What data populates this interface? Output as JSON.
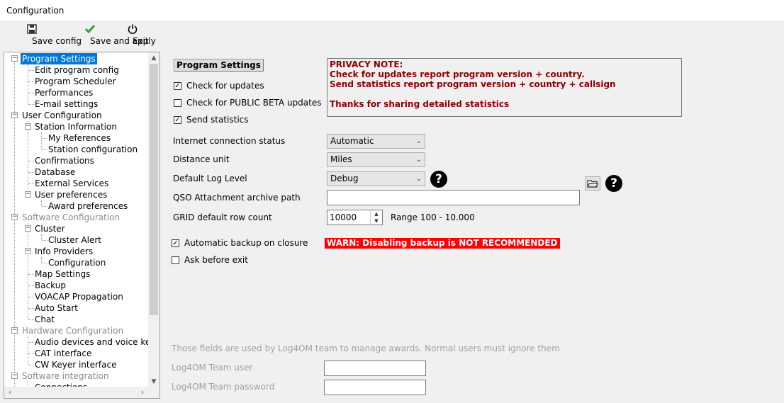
{
  "window": {
    "title": "Configuration"
  },
  "toolbar": {
    "save_config": "Save config",
    "save_apply": "Save and apply",
    "exit": "Exit"
  },
  "tree": {
    "items": [
      {
        "label": "Program Settings"
      },
      {
        "label": "Edit program config"
      },
      {
        "label": "Program Scheduler"
      },
      {
        "label": "Performances"
      },
      {
        "label": "E-mail settings"
      },
      {
        "label": "User Configuration"
      },
      {
        "label": "Station Information"
      },
      {
        "label": "My References"
      },
      {
        "label": "Station configuration"
      },
      {
        "label": "Confirmations"
      },
      {
        "label": "Database"
      },
      {
        "label": "External Services"
      },
      {
        "label": "User preferences"
      },
      {
        "label": "Award preferences"
      },
      {
        "label": "Software Configuration"
      },
      {
        "label": "Cluster"
      },
      {
        "label": "Cluster Alert"
      },
      {
        "label": "Info Providers"
      },
      {
        "label": "Configuration"
      },
      {
        "label": "Map Settings"
      },
      {
        "label": "Backup"
      },
      {
        "label": "VOACAP Propagation"
      },
      {
        "label": "Auto Start"
      },
      {
        "label": "Chat"
      },
      {
        "label": "Hardware Configuration"
      },
      {
        "label": "Audio devices and voice keye"
      },
      {
        "label": "CAT interface"
      },
      {
        "label": "CW Keyer interface"
      },
      {
        "label": "Software integration"
      },
      {
        "label": "Connections"
      }
    ]
  },
  "main": {
    "section_title": "Program Settings",
    "privacy": {
      "line1": "PRIVACY NOTE:",
      "line2": "Check for updates report program version + country.",
      "line3": "Send statistics report program version + country + callsign",
      "line4": "Thanks for sharing detailed statistics"
    },
    "check_updates": "Check for updates",
    "check_beta": "Check for PUBLIC BETA updates",
    "send_stats": "Send statistics",
    "internet_label": "Internet connection status",
    "internet_value": "Automatic",
    "distance_label": "Distance unit",
    "distance_value": "Miles",
    "loglevel_label": "Default Log Level",
    "loglevel_value": "Debug",
    "qso_label": "QSO Attachment archive path",
    "qso_value": "",
    "grid_label": "GRID default row count",
    "grid_value": "10000",
    "grid_range": "Range 100 - 10.000",
    "auto_backup": "Automatic backup on closure",
    "warn": "WARN: Disabling backup is NOT RECOMMENDED",
    "ask_exit": "Ask before exit",
    "team_note": "Those fields are used by Log4OM team to manage awards. Normal users must ignore them",
    "team_user_label": "Log4OM Team user",
    "team_pass_label": "Log4OM Team password"
  }
}
